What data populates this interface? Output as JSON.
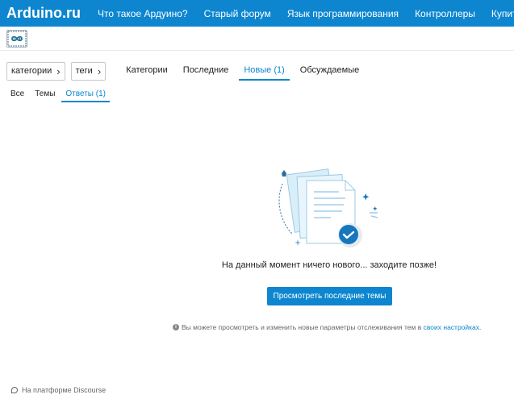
{
  "header": {
    "brand": "Arduino.ru",
    "nav": [
      "Что такое Ардуино?",
      "Старый форум",
      "Язык программирования",
      "Контроллеры",
      "Купить"
    ]
  },
  "logo": {
    "icon": "arduino-infinity-logo-icon"
  },
  "filters": {
    "categories_dropdown": "категории",
    "tags_dropdown": "теги",
    "tabs": [
      "Категории",
      "Последние",
      "Новые (1)",
      "Обсуждаемые"
    ],
    "active_tab": "Новые (1)"
  },
  "subtabs": {
    "items": [
      "Все",
      "Темы",
      "Ответы (1)"
    ],
    "active": "Ответы (1)"
  },
  "empty_state": {
    "message": "На данный момент ничего нового... заходите позже!",
    "button": "Просмотреть последние темы",
    "hint_text": "Вы можете просмотреть и изменить новые параметры отслеживания тем в",
    "hint_link": "своих настройках",
    "hint_end": "."
  },
  "footer": {
    "text": "На платформе Discourse"
  },
  "colors": {
    "accent": "#0d86cf",
    "text": "#222222",
    "muted": "#666666"
  }
}
